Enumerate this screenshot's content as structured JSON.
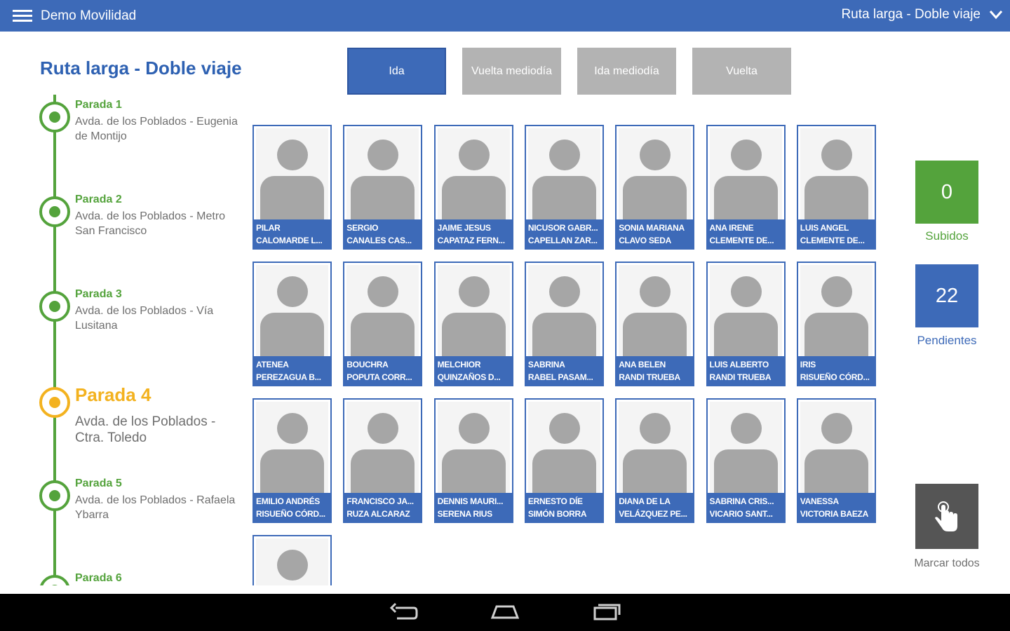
{
  "app": {
    "title": "Demo Movilidad",
    "route_selector": "Ruta larga - Doble viaje"
  },
  "route": {
    "title": "Ruta larga - Doble viaje"
  },
  "stops": [
    {
      "name": "Parada 1",
      "address": "Avda. de los Poblados - Eugenia de Montijo"
    },
    {
      "name": "Parada 2",
      "address": "Avda. de los Poblados - Metro San Francisco"
    },
    {
      "name": "Parada 3",
      "address": "Avda. de los Poblados  - Vía Lusitana"
    },
    {
      "name": "Parada 4",
      "address": "Avda. de los Poblados - Ctra. Toledo",
      "current": true
    },
    {
      "name": "Parada 5",
      "address": "Avda. de los Poblados - Rafaela Ybarra"
    },
    {
      "name": "Parada 6",
      "address": ""
    }
  ],
  "tabs": [
    {
      "label": "Ida",
      "active": true
    },
    {
      "label": "Vuelta mediodía",
      "active": false
    },
    {
      "label": "Ida mediodía",
      "active": false
    },
    {
      "label": "Vuelta",
      "active": false
    }
  ],
  "passengers": [
    {
      "line1": "PILAR",
      "line2": "CALOMARDE L..."
    },
    {
      "line1": "SERGIO",
      "line2": "CANALES CAS..."
    },
    {
      "line1": "JAIME JESUS",
      "line2": "CAPATAZ FERN..."
    },
    {
      "line1": "NICUSOR GABR...",
      "line2": "CAPELLAN ZAR..."
    },
    {
      "line1": "SONIA MARIANA",
      "line2": "CLAVO SEDA"
    },
    {
      "line1": "ANA IRENE",
      "line2": "CLEMENTE DE..."
    },
    {
      "line1": "LUIS ANGEL",
      "line2": "CLEMENTE DE..."
    },
    {
      "line1": "ATENEA",
      "line2": "PEREZAGUA B..."
    },
    {
      "line1": "BOUCHRA",
      "line2": "POPUTA CORR..."
    },
    {
      "line1": "MELCHIOR",
      "line2": "QUINZAÑOS D..."
    },
    {
      "line1": "SABRINA",
      "line2": "RABEL PASAM..."
    },
    {
      "line1": "ANA BELEN",
      "line2": "RANDI TRUEBA"
    },
    {
      "line1": "LUIS ALBERTO",
      "line2": "RANDI TRUEBA"
    },
    {
      "line1": "IRIS",
      "line2": "RISUEÑO CÓRD..."
    },
    {
      "line1": "EMILIO ANDRÉS",
      "line2": "RISUEÑO CÓRD..."
    },
    {
      "line1": "FRANCISCO JA...",
      "line2": "RUZA ALCARAZ"
    },
    {
      "line1": "DENNIS MAURI...",
      "line2": "SERENA RIUS"
    },
    {
      "line1": "ERNESTO DÍE",
      "line2": "SIMÓN BORRA"
    },
    {
      "line1": "DIANA DE LA",
      "line2": "VELÁZQUEZ PE..."
    },
    {
      "line1": "SABRINA CRIS...",
      "line2": "VICARIO SANT..."
    },
    {
      "line1": "VANESSA",
      "line2": "VICTORIA BAEZA"
    },
    {
      "line1": "",
      "line2": ""
    }
  ],
  "counters": {
    "boarded": {
      "value": "0",
      "label": "Subidos",
      "color": "#54a33c"
    },
    "pending": {
      "value": "22",
      "label": "Pendientes",
      "color": "#3d6ab8"
    }
  },
  "mark_all": {
    "label": "Marcar todos",
    "icon": "hand-pointer-icon"
  },
  "colors": {
    "primary": "#3d6ab8",
    "success": "#54a33c",
    "current_stop": "#f3b21f",
    "inactive_tab": "#b3b3b3"
  },
  "navbar": {
    "icons": [
      "back-icon",
      "home-icon",
      "recents-icon"
    ]
  }
}
